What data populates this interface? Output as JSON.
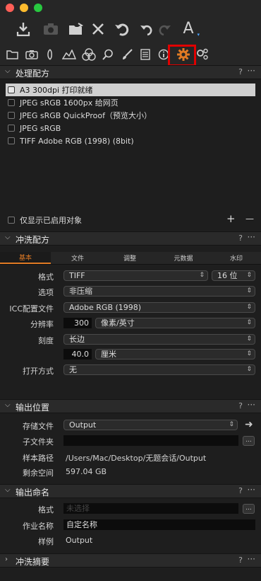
{
  "window": {
    "traffic_lights": [
      "#ff5f57",
      "#febc2e",
      "#28c840"
    ]
  },
  "toolbar": {
    "icons": [
      "import-icon",
      "camera-icon",
      "move-to-folder-icon",
      "delete-icon",
      "undo-icon",
      "undo-step-icon",
      "redo-icon",
      "text-a-icon"
    ]
  },
  "tool_tabs": {
    "icons": [
      "folder-icon",
      "camera-icon",
      "lens-icon",
      "histogram-icon",
      "color-icon",
      "search-icon",
      "brush-icon",
      "metadata-icon",
      "info-icon",
      "process-gear-icon",
      "batch-gear-icon"
    ],
    "highlight_color": "#e00000"
  },
  "process_recipes": {
    "title": "处理配方",
    "help": "?",
    "more": "···",
    "items": [
      {
        "label": "A3 300dpi 打印就绪",
        "selected": true
      },
      {
        "label": "JPEG sRGB 1600px 给网页",
        "selected": false
      },
      {
        "label": "JPEG sRGB QuickProof（预览大小）",
        "selected": false
      },
      {
        "label": "JPEG sRGB",
        "selected": false
      },
      {
        "label": "TIFF Adobe RGB (1998) (8bit)",
        "selected": false
      }
    ],
    "show_enabled_only": "仅显示已启用对象",
    "add": "+",
    "remove": "—"
  },
  "process_recipe": {
    "title": "冲洗配方",
    "help": "?",
    "more": "···",
    "tabs": [
      "基本",
      "文件",
      "调整",
      "元数据",
      "水印"
    ],
    "active_tab_color": "#e07a24",
    "format_label": "格式",
    "format_value": "TIFF",
    "bit_value": "16 位",
    "option_label": "选项",
    "option_value": "非压缩",
    "icc_label": "ICC配置文件",
    "icc_value": "Adobe RGB (1998)",
    "resolution_label": "分辨率",
    "resolution_value": "300",
    "resolution_unit": "像素/英寸",
    "scale_label": "刻度",
    "scale_value": "长边",
    "size_value": "40.0",
    "size_unit": "厘米",
    "open_with_label": "打开方式",
    "open_with_value": "无"
  },
  "output_location": {
    "title": "输出位置",
    "help": "?",
    "more": "···",
    "store_label": "存储文件",
    "store_value": "Output",
    "subfolder_label": "子文件夹",
    "subfolder_value": "",
    "sample_path_label": "样本路径",
    "sample_path_value": "/Users/Mac/Desktop/无题会话/Output",
    "free_space_label": "剩余空间",
    "free_space_value": "597.04 GB",
    "browse": "..."
  },
  "output_naming": {
    "title": "输出命名",
    "help": "?",
    "more": "···",
    "format_label": "格式",
    "format_placeholder": "未选择",
    "job_name_label": "作业名称",
    "job_name_value": "自定名称",
    "sample_label": "样例",
    "sample_value": "Output",
    "browse": "..."
  },
  "process_summary": {
    "title": "冲洗摘要",
    "help": "?",
    "more": "···"
  }
}
